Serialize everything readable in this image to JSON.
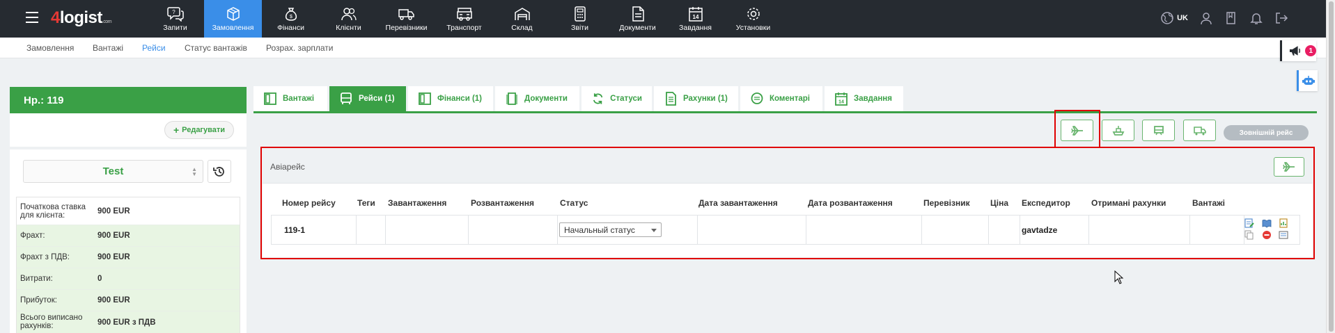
{
  "app": {
    "logo": "4logist",
    "logo_sub": ".com",
    "nav": [
      {
        "label": "Запити",
        "icon": "chat-question-icon"
      },
      {
        "label": "Замовлення",
        "icon": "box-icon",
        "active": true
      },
      {
        "label": "Фінанси",
        "icon": "money-bag-icon"
      },
      {
        "label": "Клієнти",
        "icon": "users-icon"
      },
      {
        "label": "Перевізники",
        "icon": "truck-icon"
      },
      {
        "label": "Транспорт",
        "icon": "vehicle-icon"
      },
      {
        "label": "Склад",
        "icon": "warehouse-icon"
      },
      {
        "label": "Звіти",
        "icon": "calculator-icon"
      },
      {
        "label": "Документи",
        "icon": "document-icon"
      },
      {
        "label": "Завдання",
        "icon": "calendar-icon"
      },
      {
        "label": "Установки",
        "icon": "gear-icon"
      }
    ],
    "lang": "UK"
  },
  "subnav": [
    {
      "label": "Замовлення"
    },
    {
      "label": "Вантажі"
    },
    {
      "label": "Рейси",
      "active": true
    },
    {
      "label": "Статус вантажів"
    },
    {
      "label": "Розрах. зарплати"
    }
  ],
  "notifications_count": "1",
  "order": {
    "title": "Нр.: 119",
    "edit_label": "Редагувати",
    "client": "Test",
    "finance": [
      {
        "label": "Початкова ставка для клієнта:",
        "value": "900 EUR"
      },
      {
        "label": "Фрахт:",
        "value": "900 EUR"
      },
      {
        "label": "Фрахт з ПДВ:",
        "value": "900 EUR"
      },
      {
        "label": "Витрати:",
        "value": "0"
      },
      {
        "label": "Прибуток:",
        "value": "900 EUR"
      },
      {
        "label": "Всього виписано рахунків:",
        "value": "900 EUR з ПДВ"
      }
    ]
  },
  "tabs": [
    {
      "label": "Вантажі",
      "icon": "cargo-icon"
    },
    {
      "label": "Рейси (1)",
      "icon": "bus-icon",
      "active": true
    },
    {
      "label": "Фінанси (1)",
      "icon": "finance-icon"
    },
    {
      "label": "Документи",
      "icon": "document-icon"
    },
    {
      "label": "Статуси",
      "icon": "refresh-icon"
    },
    {
      "label": "Рахунки (1)",
      "icon": "invoice-icon"
    },
    {
      "label": "Коментарі",
      "icon": "comment-icon"
    },
    {
      "label": "Завдання",
      "icon": "calendar-icon"
    }
  ],
  "transport_buttons": [
    "plane-icon",
    "ship-icon",
    "train-icon",
    "truck-icon"
  ],
  "external_trip_label": "Зовнішній рейс",
  "section": {
    "title": "Авіарейс",
    "columns": [
      "Номер рейсу",
      "Теги",
      "Завантаження",
      "Розвантаження",
      "Статус",
      "Дата завантаження",
      "Дата розвантаження",
      "Перевізник",
      "Ціна",
      "Експедитор",
      "Отримані рахунки",
      "Вантажі"
    ],
    "row": {
      "trip_number": "119-1",
      "tags": "",
      "loading": "",
      "unloading": "",
      "status": "Начальный статус",
      "load_date": "",
      "unload_date": "",
      "carrier": "",
      "price": "",
      "forwarder": "gavtadze",
      "invoices": "",
      "cargo": ""
    }
  },
  "colors": {
    "topbar": "#262b31",
    "active_nav": "#3a8ee8",
    "green": "#3aa046",
    "highlight_red": "#e00000"
  }
}
